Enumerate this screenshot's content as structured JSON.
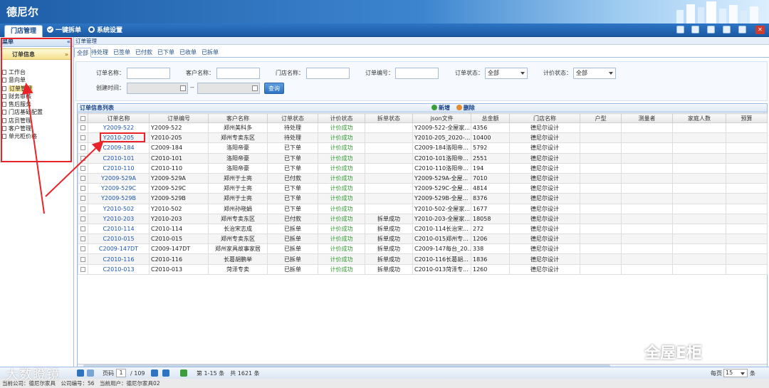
{
  "app": {
    "title": "德尼尔"
  },
  "nav": {
    "tabs": [
      {
        "label": "门店管理"
      },
      {
        "label": "一键拆单"
      },
      {
        "label": "系统设置"
      }
    ],
    "close_glyph": "✕"
  },
  "sidebar": {
    "header": "菜单",
    "collapse_glyph": "«",
    "group": "订单信息",
    "group_toggle_glyph": "»",
    "items": [
      "工作台",
      "意向单",
      "订单管理",
      "财务审核",
      "售后服务",
      "门店基础配置",
      "店员管理",
      "客户管理",
      "单元柜价格"
    ],
    "active_item": "订单管理"
  },
  "main": {
    "breadcrumb": "订单管理",
    "status_tabs": [
      "全部",
      "待处理",
      "已签单",
      "已付款",
      "已下单",
      "已收单",
      "已拆单"
    ],
    "active_status_tab": "全部"
  },
  "filter": {
    "order_name": {
      "label": "订单名称：",
      "value": ""
    },
    "customer_name": {
      "label": "客户名称：",
      "value": ""
    },
    "store_name": {
      "label": "门店名称：",
      "value": ""
    },
    "order_no": {
      "label": "订单编号：",
      "value": ""
    },
    "order_status": {
      "label": "订单状态：",
      "value": "全部"
    },
    "price_status": {
      "label": "计价状态：",
      "value": "全部"
    },
    "created_time": {
      "label": "创建时间：",
      "separator": "--"
    },
    "query_button": "查询"
  },
  "grid": {
    "title": "订单信息列表",
    "add_label": "新增",
    "delete_label": "删除",
    "columns": [
      "订单名称",
      "订单编号",
      "客户名称",
      "订单状态",
      "计价状态",
      "拆单状态",
      "json文件",
      "总金额",
      "门店名称",
      "户型",
      "测量者",
      "家庭人数",
      "预算"
    ],
    "rows": [
      [
        "Y2009-522",
        "Y2009-522",
        "郑州美科多",
        "待处理",
        "计价成功",
        "",
        "Y2009-522-全屋家...",
        "4356",
        "德尼尔设计",
        "",
        "",
        "",
        ""
      ],
      [
        "Y2010-205",
        "Y2010-205",
        "郑州专卖东区",
        "待处理",
        "计价成功",
        "",
        "Y2010-205_2020-...",
        "10400",
        "德尼尔设计",
        "",
        "",
        "",
        ""
      ],
      [
        "C2009-184",
        "C2009-184",
        "洛阳帝豪",
        "已下单",
        "计价成功",
        "",
        "C2009-184洛阳帝...",
        "5792",
        "德尼尔设计",
        "",
        "",
        "",
        ""
      ],
      [
        "C2010-101",
        "C2010-101",
        "洛阳帝豪",
        "已下单",
        "计价成功",
        "",
        "C2010-101洛阳帝...",
        "2551",
        "德尼尔设计",
        "",
        "",
        "",
        ""
      ],
      [
        "C2010-110",
        "C2010-110",
        "洛阳帝豪",
        "已下单",
        "计价成功",
        "",
        "C2010-110洛阳帝...",
        "194",
        "德尼尔设计",
        "",
        "",
        "",
        ""
      ],
      [
        "Y2009-529A",
        "Y2009-529A",
        "郑州于士亮",
        "已付款",
        "计价成功",
        "",
        "Y2009-529A-全屋...",
        "7010",
        "德尼尔设计",
        "",
        "",
        "",
        ""
      ],
      [
        "Y2009-529C",
        "Y2009-529C",
        "郑州于士亮",
        "已下单",
        "计价成功",
        "",
        "Y2009-529C-全屋...",
        "4814",
        "德尼尔设计",
        "",
        "",
        "",
        ""
      ],
      [
        "Y2009-529B",
        "Y2009-529B",
        "郑州于士亮",
        "已下单",
        "计价成功",
        "",
        "Y2009-529B-全屋...",
        "8376",
        "德尼尔设计",
        "",
        "",
        "",
        ""
      ],
      [
        "Y2010-502",
        "Y2010-502",
        "郑州孙晓娟",
        "已下单",
        "计价成功",
        "",
        "Y2010-502-全屋家...",
        "1677",
        "德尼尔设计",
        "",
        "",
        "",
        ""
      ],
      [
        "Y2010-203",
        "Y2010-203",
        "郑州专卖东区",
        "已付款",
        "计价成功",
        "拆单成功",
        "Y2010-203-全屋家...",
        "18058",
        "德尼尔设计",
        "",
        "",
        "",
        ""
      ],
      [
        "C2010-114",
        "C2010-114",
        "长治宋志成",
        "已拆单",
        "计价成功",
        "拆单成功",
        "C2010-114长治宋...",
        "272",
        "德尼尔设计",
        "",
        "",
        "",
        ""
      ],
      [
        "C2010-015",
        "C2010-015",
        "郑州专卖东区",
        "已拆单",
        "计价成功",
        "拆单成功",
        "C2010-015郑州专...",
        "1206",
        "德尼尔设计",
        "",
        "",
        "",
        ""
      ],
      [
        "C2009-147DT",
        "C2009-147DT",
        "郑州家具故事家居",
        "已拆单",
        "计价成功",
        "拆单成功",
        "C2009-147每台_20...",
        "338",
        "德尼尔设计",
        "",
        "",
        "",
        ""
      ],
      [
        "C2010-116",
        "C2010-116",
        "长葛胡鹏举",
        "已拆单",
        "计价成功",
        "拆单成功",
        "C2010-116长葛胡...",
        "1836",
        "德尼尔设计",
        "",
        "",
        "",
        ""
      ],
      [
        "C2010-013",
        "C2010-013",
        "菏泽专卖",
        "已拆单",
        "计价成功",
        "拆单成功",
        "C2010-013菏泽专...",
        "1260",
        "德尼尔设计",
        "",
        "",
        "",
        ""
      ]
    ]
  },
  "pager": {
    "page_label": "页码",
    "page_value": "1",
    "total_pages": "/ 109",
    "range_text": "第 1-15 条　共 1621 条",
    "per_page_label": "每页",
    "per_page_value": "15",
    "per_page_unit": "条"
  },
  "statusbar": {
    "text": "当前公司：德尼尔家具　公司编号：56　当前用户：德尼尔家具02"
  },
  "watermarks": {
    "left": "大数瞪镜",
    "right": "全屋E柜"
  }
}
